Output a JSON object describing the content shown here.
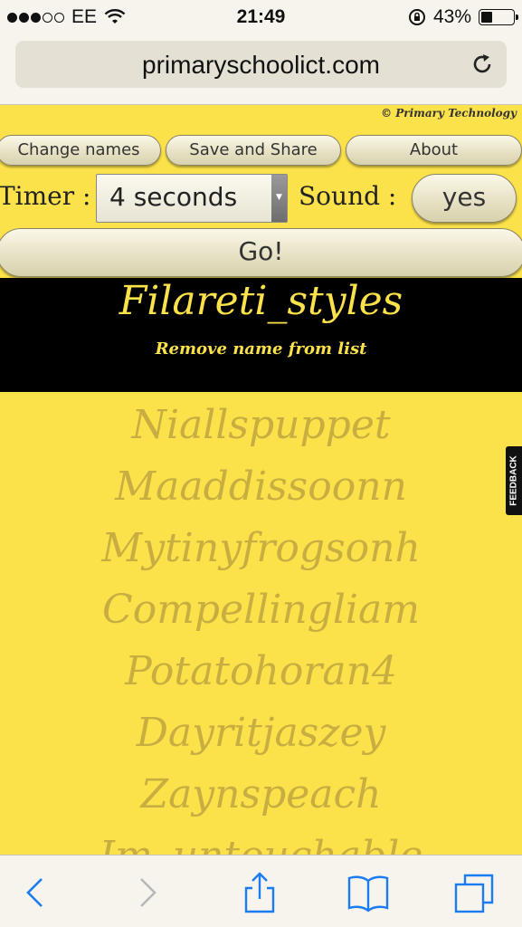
{
  "status_bar": {
    "carrier": "EE",
    "time": "21:49",
    "battery": "43%",
    "battery_level": 0.43
  },
  "browser": {
    "url": "primaryschoolict.com"
  },
  "page": {
    "credit": "© Primary Technology",
    "buttons": {
      "change_names": "Change names",
      "save_share": "Save and Share",
      "about": "About",
      "go": "Go!"
    },
    "timer": {
      "label": "Timer :",
      "value": "4 seconds"
    },
    "sound": {
      "label": "Sound :",
      "value": "yes"
    },
    "selected": {
      "name": "Filareti_styles",
      "remove_label": "Remove name from list"
    },
    "names": [
      "Niallspuppet",
      "Maaddissoonn",
      "Mytinyfrogsonh",
      "Compellingliam",
      "Potatohoran4",
      "Dayritjaszey",
      "Zaynspeach",
      "Im_untouchable"
    ],
    "feedback": "FEEDBACK"
  },
  "colors": {
    "page_bg": "#fbe14a",
    "banner_bg": "#000000",
    "banner_text": "#fbe14a",
    "name_list_text": "#c3a93f",
    "ios_blue": "#1a7cf2"
  },
  "icons": [
    "signal-dots-icon",
    "wifi-icon",
    "rotation-lock-icon",
    "battery-icon",
    "reload-icon",
    "back-icon",
    "forward-icon",
    "share-icon",
    "bookmarks-icon",
    "tabs-icon"
  ]
}
